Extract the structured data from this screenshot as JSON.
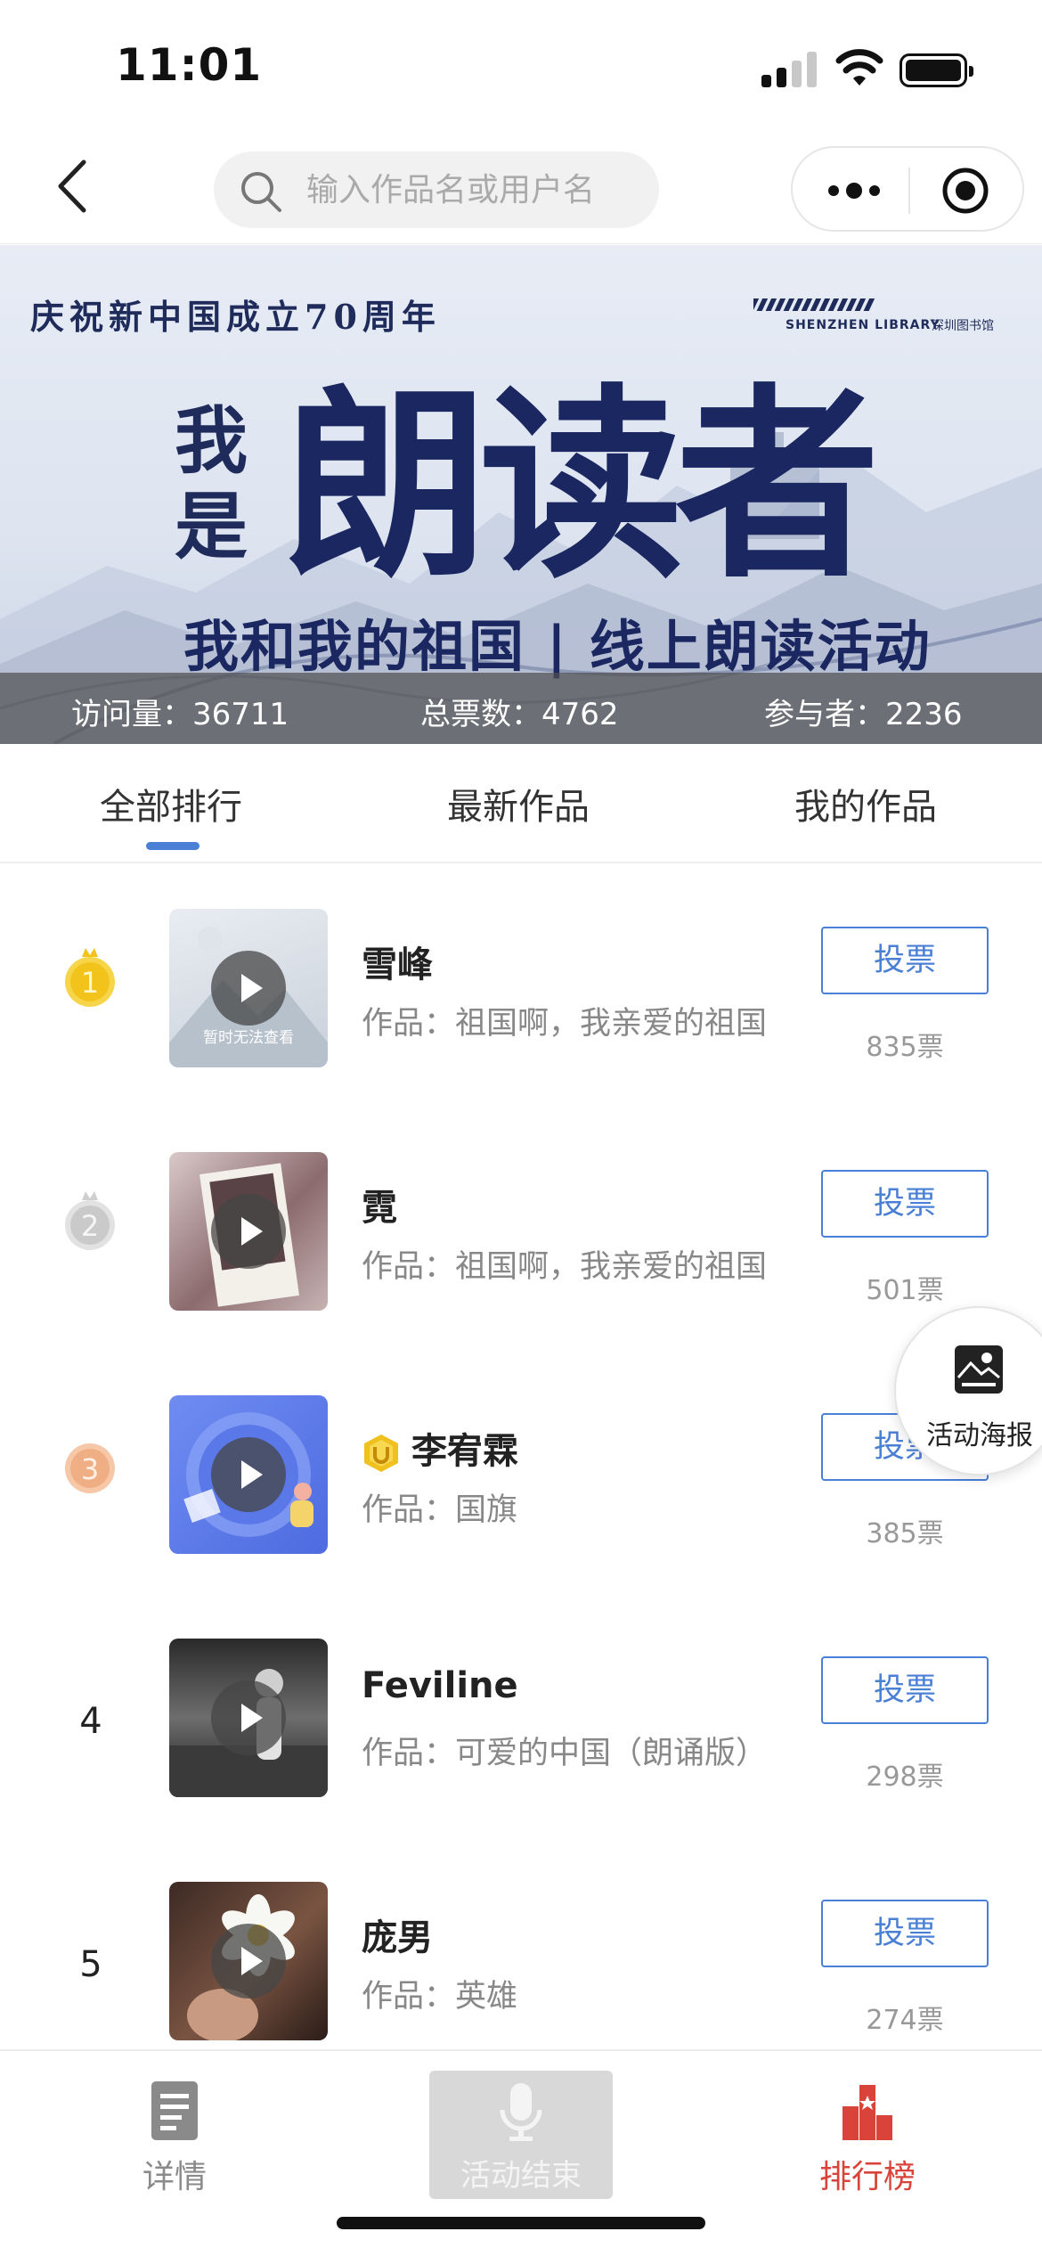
{
  "status_bar": {
    "time": "11:01"
  },
  "nav": {
    "search_placeholder": "输入作品名或用户名",
    "icons": {
      "back": "chevron-left-icon",
      "more": "more-dots-icon",
      "close": "record-icon"
    }
  },
  "banner": {
    "topline": "庆祝新中国成立70周年",
    "brand": "SHENZHEN LIBRARY",
    "brand_cn": "深圳图书馆",
    "small_text": "我是",
    "big_text": "朗读者",
    "subtitle": "我和我的祖国 | 线上朗读活动",
    "stats": {
      "visits": "访问量：36711",
      "votes": "总票数：4762",
      "participants": "参与者：2236"
    }
  },
  "tabs": [
    {
      "label": "全部排行",
      "active": true
    },
    {
      "label": "最新作品",
      "active": false
    },
    {
      "label": "我的作品",
      "active": false
    }
  ],
  "ranking": [
    {
      "rank": "1",
      "name": "雪峰",
      "work": "作品：祖国啊，我亲爱的祖国",
      "vote_label": "投票",
      "votes": "835票",
      "thumb_note": "暂时无法查看"
    },
    {
      "rank": "2",
      "name": "霓",
      "work": "作品：祖国啊，我亲爱的祖国",
      "vote_label": "投票",
      "votes": "501票"
    },
    {
      "rank": "3",
      "name": "李宥霖",
      "work": "作品：国旗",
      "vote_label": "投票",
      "votes": "385票"
    },
    {
      "rank": "4",
      "name": "Feviline",
      "work": "作品：可爱的中国（朗诵版）",
      "vote_label": "投票",
      "votes": "298票"
    },
    {
      "rank": "5",
      "name": "庞男",
      "work": "作品：英雄",
      "vote_label": "投票",
      "votes": "274票"
    }
  ],
  "float_poster": {
    "label": "活动海报"
  },
  "bottom_bar": {
    "details": "详情",
    "ended": "活动结束",
    "ranking": "排行榜"
  },
  "colors": {
    "accent_blue": "#4a7fd6",
    "active_red": "#d9433a",
    "gold": "#f2c31b",
    "silver": "#c9c9c9",
    "bronze": "#f0b08a"
  }
}
